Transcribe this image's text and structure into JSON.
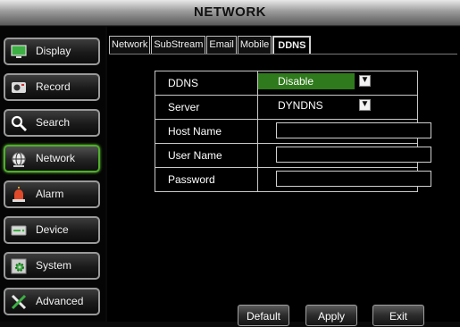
{
  "window": {
    "title": "NETWORK"
  },
  "sidebar": {
    "items": [
      {
        "label": "Display",
        "icon": "monitor-icon"
      },
      {
        "label": "Record",
        "icon": "camera-icon"
      },
      {
        "label": "Search",
        "icon": "magnifier-icon"
      },
      {
        "label": "Network",
        "icon": "globe-icon",
        "active": true
      },
      {
        "label": "Alarm",
        "icon": "alarm-light-icon"
      },
      {
        "label": "Device",
        "icon": "hard-drive-icon"
      },
      {
        "label": "System",
        "icon": "gear-icon"
      },
      {
        "label": "Advanced",
        "icon": "tools-icon"
      }
    ]
  },
  "tabs": [
    {
      "label": "Network"
    },
    {
      "label": "SubStream"
    },
    {
      "label": "Email"
    },
    {
      "label": "Mobile"
    },
    {
      "label": "DDNS",
      "active": true
    }
  ],
  "form": {
    "ddns": {
      "label": "DDNS",
      "value": "Disable"
    },
    "server": {
      "label": "Server",
      "value": "DYNDNS"
    },
    "host_name": {
      "label": "Host Name",
      "value": ""
    },
    "user_name": {
      "label": "User Name",
      "value": ""
    },
    "password": {
      "label": "Password",
      "value": ""
    }
  },
  "buttons": {
    "default": "Default",
    "apply": "Apply",
    "exit": "Exit"
  },
  "colors": {
    "accent_green": "#2f7a1c",
    "active_border": "#4fae2d",
    "background": "#000000"
  }
}
